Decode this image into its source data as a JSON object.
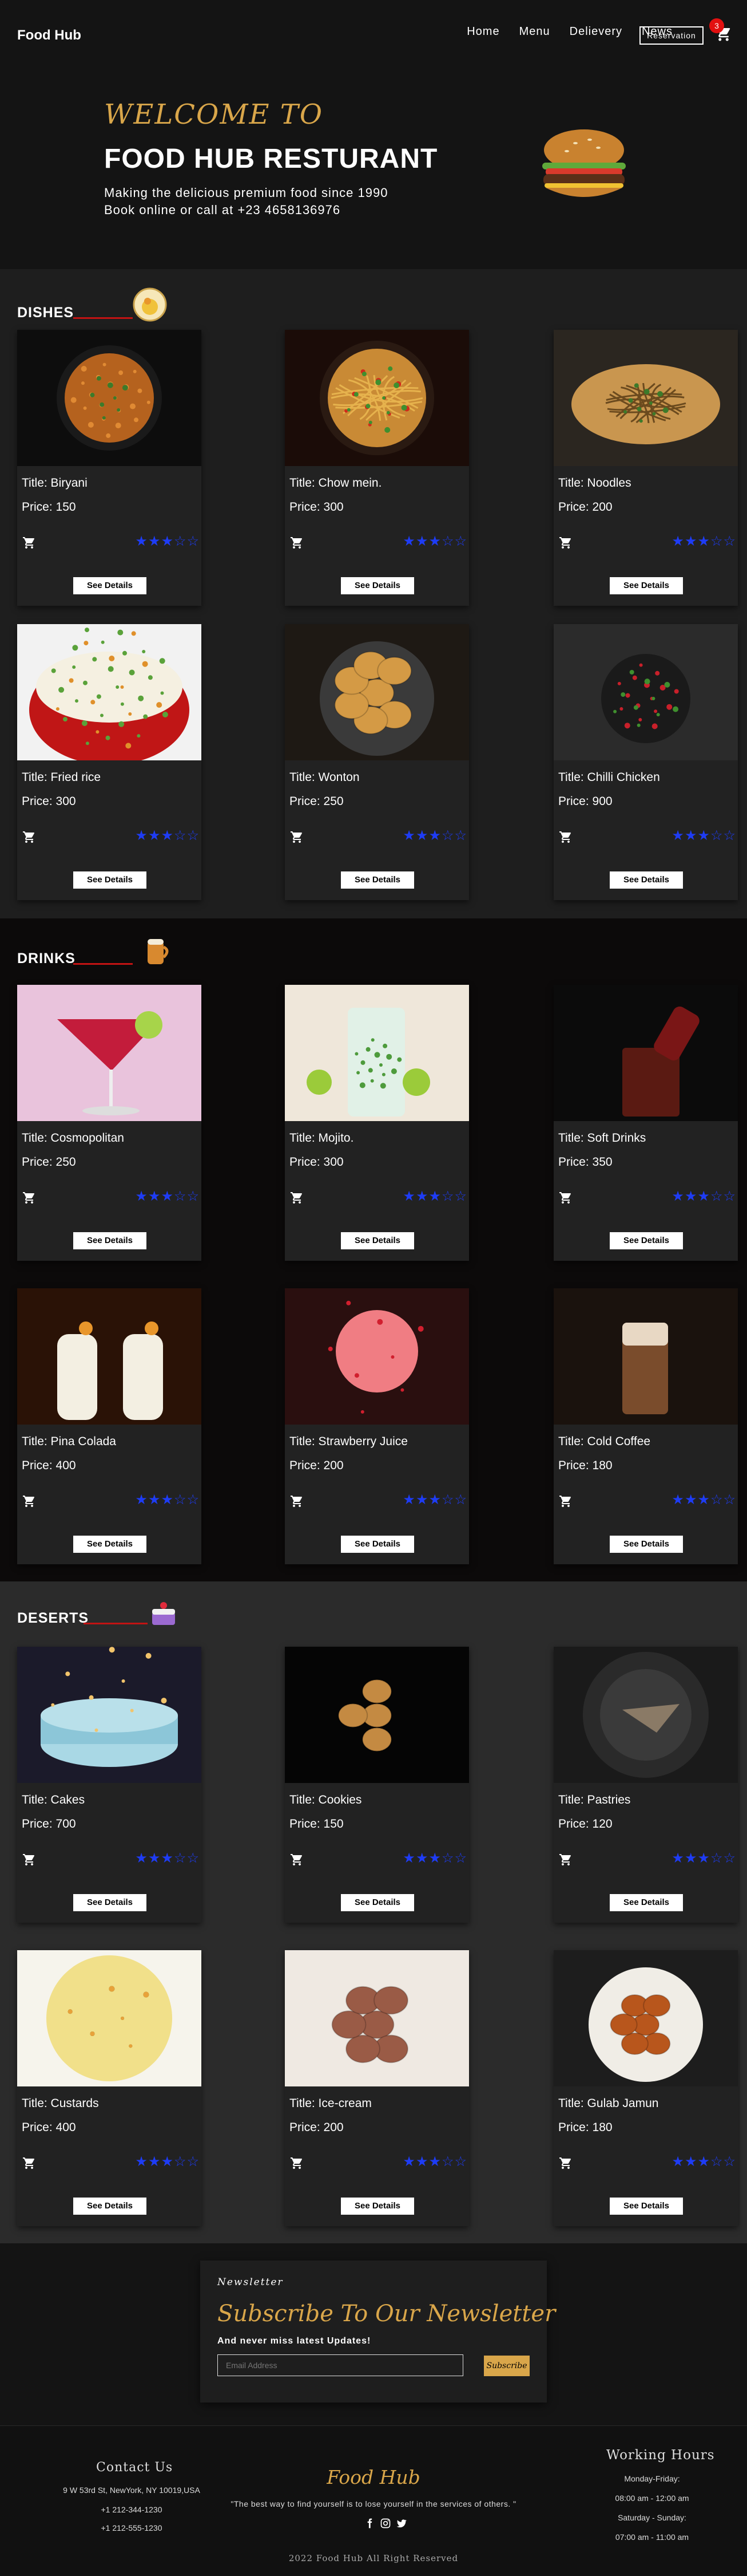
{
  "nav": {
    "brand": "Food Hub",
    "links": [
      "Home",
      "Menu",
      "Delievery",
      "News"
    ],
    "reservation": "Reservation",
    "cart_count": "3"
  },
  "hero": {
    "welcome": "WELCOME TO",
    "title": "FOOD HUB RESTURANT",
    "line1": "Making the delicious premium food since 1990",
    "line2": "Book online or call at +23 4658136976"
  },
  "common": {
    "details_label": "See Details",
    "star_full": "★",
    "star_empty": "☆"
  },
  "sections": [
    {
      "title": "DISHES",
      "items": [
        {
          "title": "Title: Biryani",
          "price": "Price: 150",
          "rating": 3
        },
        {
          "title": "Title: Chow mein.",
          "price": "Price: 300",
          "rating": 3
        },
        {
          "title": "Title: Noodles",
          "price": "Price: 200",
          "rating": 3
        },
        {
          "title": "Title: Fried rice",
          "price": "Price: 300",
          "rating": 3
        },
        {
          "title": "Title: Wonton",
          "price": "Price: 250",
          "rating": 3
        },
        {
          "title": "Title: Chilli Chicken",
          "price": "Price: 900",
          "rating": 3
        }
      ]
    },
    {
      "title": "DRINKS",
      "items": [
        {
          "title": "Title: Cosmopolitan",
          "price": "Price: 250",
          "rating": 3
        },
        {
          "title": "Title: Mojito.",
          "price": "Price: 300",
          "rating": 3
        },
        {
          "title": "Title: Soft Drinks",
          "price": "Price: 350",
          "rating": 3
        },
        {
          "title": "Title: Pina Colada",
          "price": "Price: 400",
          "rating": 3
        },
        {
          "title": "Title: Strawberry Juice",
          "price": "Price: 200",
          "rating": 3
        },
        {
          "title": "Title: Cold Coffee",
          "price": "Price: 180",
          "rating": 3
        }
      ]
    },
    {
      "title": "DESERTS",
      "items": [
        {
          "title": "Title: Cakes",
          "price": "Price: 700",
          "rating": 3
        },
        {
          "title": "Title: Cookies",
          "price": "Price: 150",
          "rating": 3
        },
        {
          "title": "Title: Pastries",
          "price": "Price: 120",
          "rating": 3
        },
        {
          "title": "Title: Custards",
          "price": "Price: 400",
          "rating": 3
        },
        {
          "title": "Title: Ice-cream",
          "price": "Price: 200",
          "rating": 3
        },
        {
          "title": "Title: Gulab Jamun",
          "price": "Price: 180",
          "rating": 3
        }
      ]
    }
  ],
  "newsletter": {
    "label": "Newsletter",
    "title": "Subscribe To Our Newsletter",
    "subtitle": "And never miss latest Updates!",
    "placeholder": "Email Address",
    "button": "Subscribe"
  },
  "footer": {
    "contact_heading": "Contact Us",
    "address": "9 W 53rd St, NewYork, NY 10019,USA",
    "phone1": "+1 212-344-1230",
    "phone2": "+1 212-555-1230",
    "brand": "Food Hub",
    "quote": "\"The best way to find yourself is to lose yourself in the services of others. \"",
    "hours_heading": "Working Hours",
    "weekday_label": "Monday-Friday:",
    "weekday_hours": "08:00 am - 12:00 am",
    "weekend_label": "Saturday - Sunday:",
    "weekend_hours": "07:00 am - 11:00 am",
    "copyright": "2022 Food Hub All Right Reserved"
  }
}
